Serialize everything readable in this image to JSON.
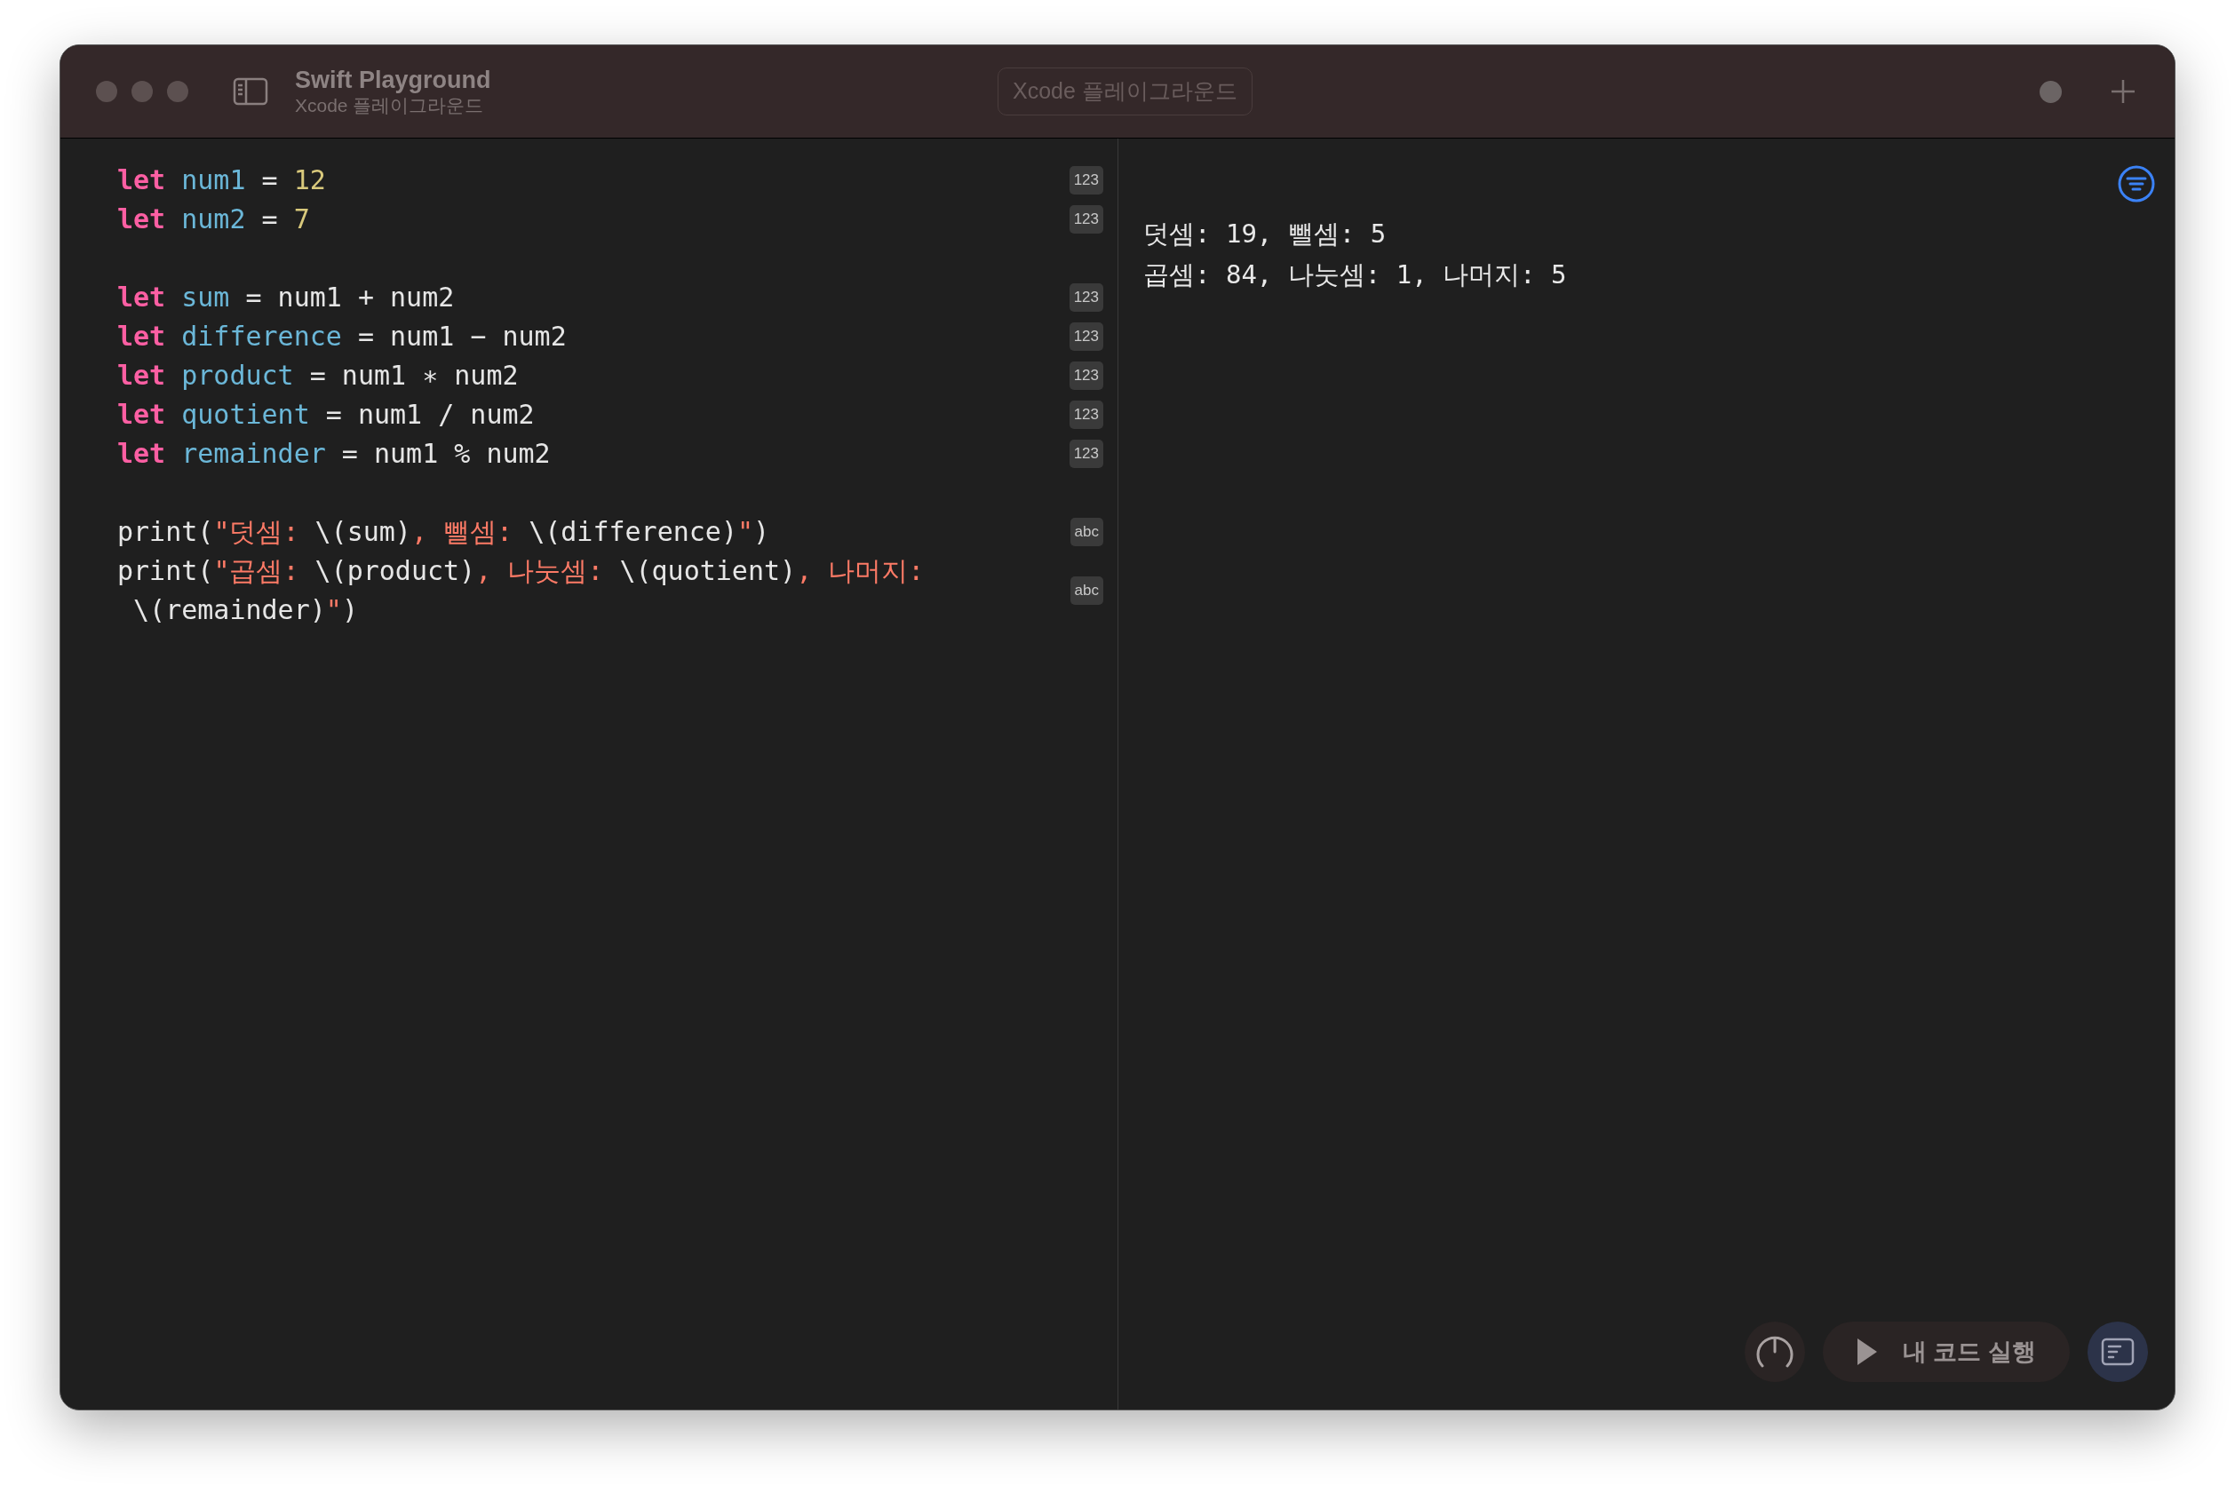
{
  "window": {
    "title": "Swift Playground",
    "subtitle": "Xcode 플레이그라운드",
    "scheme": "Xcode 플레이그라운드"
  },
  "editor": {
    "lines": [
      {
        "kind": "code",
        "badge": "123",
        "wrapped_lines": [
          {
            "spans": [
              {
                "kind": "keyword",
                "text": "let"
              },
              {
                "kind": "identifier",
                "text": " num1"
              },
              {
                "kind": "plain",
                "text": " = "
              },
              {
                "kind": "number",
                "text": "12"
              }
            ]
          }
        ]
      },
      {
        "kind": "code",
        "badge": "123",
        "wrapped_lines": [
          {
            "spans": [
              {
                "kind": "keyword",
                "text": "let"
              },
              {
                "kind": "identifier",
                "text": " num2"
              },
              {
                "kind": "plain",
                "text": " = "
              },
              {
                "kind": "number",
                "text": "7"
              }
            ]
          }
        ]
      },
      {
        "kind": "blank"
      },
      {
        "kind": "code",
        "badge": "123",
        "wrapped_lines": [
          {
            "spans": [
              {
                "kind": "keyword",
                "text": "let"
              },
              {
                "kind": "identifier",
                "text": " sum"
              },
              {
                "kind": "plain",
                "text": " = num1 + num2"
              }
            ]
          }
        ]
      },
      {
        "kind": "code",
        "badge": "123",
        "wrapped_lines": [
          {
            "spans": [
              {
                "kind": "keyword",
                "text": "let"
              },
              {
                "kind": "identifier",
                "text": " difference"
              },
              {
                "kind": "plain",
                "text": " = num1 − num2"
              }
            ]
          }
        ]
      },
      {
        "kind": "code",
        "badge": "123",
        "wrapped_lines": [
          {
            "spans": [
              {
                "kind": "keyword",
                "text": "let"
              },
              {
                "kind": "identifier",
                "text": " product"
              },
              {
                "kind": "plain",
                "text": " = num1 ∗ num2"
              }
            ]
          }
        ]
      },
      {
        "kind": "code",
        "badge": "123",
        "wrapped_lines": [
          {
            "spans": [
              {
                "kind": "keyword",
                "text": "let"
              },
              {
                "kind": "identifier",
                "text": " quotient"
              },
              {
                "kind": "plain",
                "text": " = num1 / num2"
              }
            ]
          }
        ]
      },
      {
        "kind": "code",
        "badge": "123",
        "wrapped_lines": [
          {
            "spans": [
              {
                "kind": "keyword",
                "text": "let"
              },
              {
                "kind": "identifier",
                "text": " remainder"
              },
              {
                "kind": "plain",
                "text": " = num1 % num2"
              }
            ]
          }
        ]
      },
      {
        "kind": "blank"
      },
      {
        "kind": "code",
        "badge": "abc",
        "wrapped_lines": [
          {
            "spans": [
              {
                "kind": "plain",
                "text": "print("
              },
              {
                "kind": "string",
                "text": "\"덧셈: "
              },
              {
                "kind": "plain",
                "text": "\\(sum)"
              },
              {
                "kind": "string",
                "text": ", 뺄셈: "
              },
              {
                "kind": "plain",
                "text": "\\(difference)"
              },
              {
                "kind": "string",
                "text": "\""
              },
              {
                "kind": "plain",
                "text": ")"
              }
            ]
          }
        ]
      },
      {
        "kind": "code",
        "badge": "abc",
        "wrapped_lines": [
          {
            "spans": [
              {
                "kind": "plain",
                "text": "print("
              },
              {
                "kind": "string",
                "text": "\"곱셈: "
              },
              {
                "kind": "plain",
                "text": "\\(product)"
              },
              {
                "kind": "string",
                "text": ", 나눗셈: "
              },
              {
                "kind": "plain",
                "text": "\\(quotient)"
              },
              {
                "kind": "string",
                "text": ", 나머지:"
              }
            ]
          },
          {
            "spans": [
              {
                "kind": "plain",
                "text": " \\(remainder)"
              },
              {
                "kind": "string",
                "text": "\""
              },
              {
                "kind": "plain",
                "text": ")"
              }
            ]
          }
        ]
      }
    ]
  },
  "output": {
    "lines": [
      "덧셈: 19, 뺄셈: 5",
      "곱셈: 84, 나눗셈: 1, 나머지: 5"
    ]
  },
  "toolbar": {
    "run_label": "내 코드 실행",
    "console_selected": true
  }
}
